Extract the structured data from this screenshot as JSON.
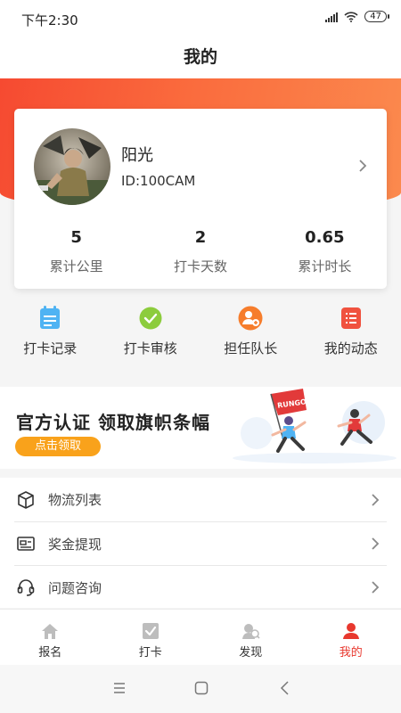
{
  "status_bar": {
    "time": "下午2:30",
    "battery": "47",
    "icons": [
      "signal-icon",
      "wifi-icon",
      "battery-icon"
    ]
  },
  "page": {
    "title": "我的"
  },
  "profile": {
    "name": "阳光",
    "id_text": "ID:100CAM",
    "avatar": "avatar-photo"
  },
  "stats": [
    {
      "value": "5",
      "label": "累计公里"
    },
    {
      "value": "2",
      "label": "打卡天数"
    },
    {
      "value": "0.65",
      "label": "累计时长"
    }
  ],
  "quick_actions": [
    {
      "label": "打卡记录",
      "icon": "calendar-icon",
      "color": "#4fb3f3"
    },
    {
      "label": "打卡审核",
      "icon": "check-circle-icon",
      "color": "#8ccc3d"
    },
    {
      "label": "担任队长",
      "icon": "captain-icon",
      "color": "#f67d2c"
    },
    {
      "label": "我的动态",
      "icon": "list-icon",
      "color": "#f0523f"
    }
  ],
  "banner": {
    "title": "官方认证 领取旗帜条幅",
    "button": "点击领取",
    "flag_text": "RUNGO"
  },
  "menu": [
    {
      "label": "物流列表",
      "icon": "box-icon"
    },
    {
      "label": "奖金提现",
      "icon": "wallet-icon"
    },
    {
      "label": "问题咨询",
      "icon": "headset-icon"
    }
  ],
  "tabs": [
    {
      "label": "报名",
      "icon": "home-icon",
      "active": false
    },
    {
      "label": "打卡",
      "icon": "checkbox-icon",
      "active": false
    },
    {
      "label": "发现",
      "icon": "discover-icon",
      "active": false
    },
    {
      "label": "我的",
      "icon": "user-icon",
      "active": true
    }
  ],
  "colors": {
    "accent": "#e8382e",
    "header_start": "#f64a31",
    "header_end": "#fb8a4e",
    "banner_button": "#f9a21b"
  }
}
